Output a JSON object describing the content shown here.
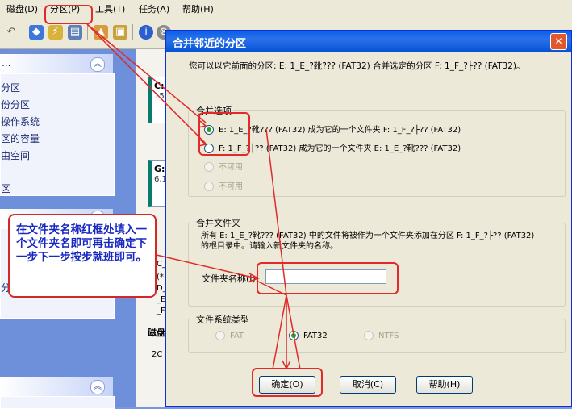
{
  "menu": {
    "items": [
      "磁盘(D)",
      "分区(P)",
      "工具(T)",
      "任务(A)",
      "帮助(H)"
    ]
  },
  "left_panel": {
    "top_dots": "...",
    "items": [
      "分区",
      "份分区",
      "操作系统",
      "区的容量",
      "由空间",
      "区"
    ],
    "lower_item": "分区"
  },
  "middle": {
    "disk1_label": "C:",
    "disk1_sub": "15,",
    "disk2_label": "G:",
    "disk2_sub": "6,1",
    "lines": [
      "C_",
      "(*",
      "D_",
      "_E",
      "_F"
    ],
    "disk_title": "磁盘",
    "bottom_code": "2C"
  },
  "dialog": {
    "title": "合并邻近的分区",
    "close_symbol": "✕",
    "description": "您可以以它前面的分区: E: 1_E_?靴??? (FAT32) 合并选定的分区 F: 1_F_?├?? (FAT32)。",
    "merge_options": {
      "legend": "合并选项",
      "options": [
        "E: 1_E_?靴??? (FAT32)  成为它的一个文件夹  F: 1_F_?├?? (FAT32)",
        "F: 1_F_?├?? (FAT32)  成为它的一个文件夹  E: 1_E_?靴??? (FAT32)",
        "不可用",
        "不可用"
      ],
      "selected": 0
    },
    "merge_folder": {
      "legend": "合并文件夹",
      "text": "所有 E: 1_E_?靴??? (FAT32) 中的文件将被作为一个文件夹添加在分区 F: 1_F_?├?? (FAT32) 的根目录中。请输入新文件夹的名称。",
      "label": "文件夹名称(I):",
      "value": ""
    },
    "filesystem": {
      "legend": "文件系统类型",
      "options": [
        "FAT",
        "FAT32",
        "NTFS"
      ],
      "selected": 1
    },
    "buttons": {
      "ok": "确定(O)",
      "cancel": "取消(C)",
      "help": "帮助(H)"
    }
  },
  "annotation": {
    "text": "在文件夹名称红框处填入一个文件夹名即可再击确定下一步下一步按步就班即可。"
  },
  "colors": {
    "title_blue": "#0a5ee8",
    "dialog_bg": "#ece9d8",
    "annotation_red": "#e12a2a",
    "annotation_text": "#1828c0"
  }
}
